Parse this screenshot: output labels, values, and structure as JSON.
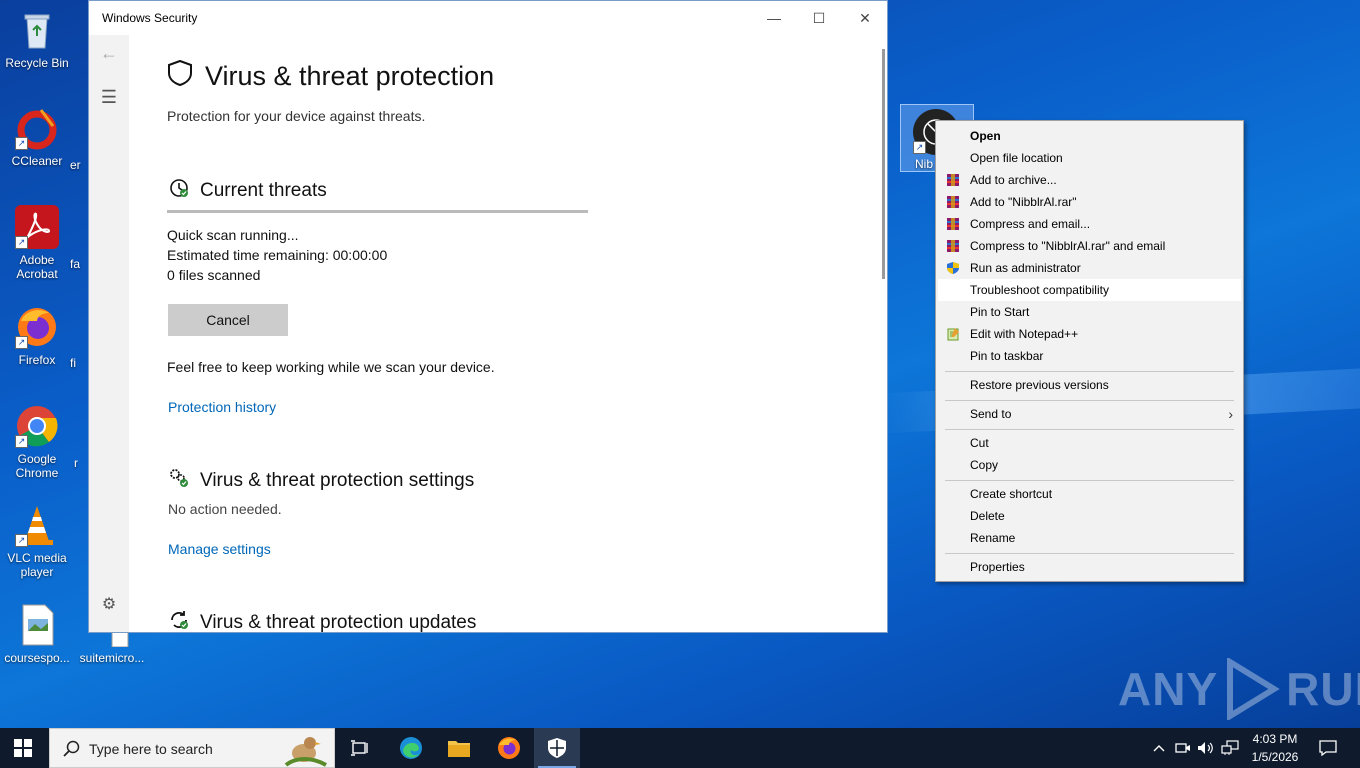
{
  "desktop": {
    "icons": [
      {
        "label": "Recycle Bin"
      },
      {
        "label": "CCleaner"
      },
      {
        "label": "Adobe Acrobat"
      },
      {
        "label": "Firefox"
      },
      {
        "label": "Google Chrome"
      },
      {
        "label": "VLC media player"
      },
      {
        "label": "coursespo..."
      },
      {
        "label": "suitemicro..."
      }
    ],
    "partial_labels": [
      "er",
      "fa",
      "fi",
      "r"
    ],
    "selected_icon_label": "Nib"
  },
  "window": {
    "title": "Windows Security",
    "page_title": "Virus & threat protection",
    "subtitle": "Protection for your device against threats.",
    "current_threats": {
      "heading": "Current threats",
      "progress": 1.0,
      "status": "Quick scan running...",
      "time_label": "Estimated time remaining:",
      "time_value": "00:00:00",
      "files_count": "0",
      "files_label": "files scanned",
      "cancel_label": "Cancel",
      "note": "Feel free to keep working while we scan your device.",
      "history_link": "Protection history"
    },
    "settings": {
      "heading": "Virus & threat protection settings",
      "status": "No action needed.",
      "link": "Manage settings"
    },
    "updates": {
      "heading": "Virus & threat protection updates"
    }
  },
  "context_menu": {
    "items": [
      {
        "label": "Open",
        "bold": true
      },
      {
        "label": "Open file location"
      },
      {
        "label": "Add to archive...",
        "icon": "winrar-icon"
      },
      {
        "label": "Add to \"NibblrAl.rar\"",
        "icon": "winrar-icon"
      },
      {
        "label": "Compress and email...",
        "icon": "winrar-icon"
      },
      {
        "label": "Compress to \"NibblrAl.rar\" and email",
        "icon": "winrar-icon"
      },
      {
        "label": "Run as administrator",
        "icon": "uac-shield-icon"
      },
      {
        "label": "Troubleshoot compatibility",
        "highlight": true
      },
      {
        "label": "Pin to Start"
      },
      {
        "label": "Edit with Notepad++",
        "icon": "notepadpp-icon"
      },
      {
        "label": "Pin to taskbar"
      },
      {
        "label": "Restore previous versions"
      },
      {
        "label": "Send to",
        "submenu": true
      },
      {
        "label": "Cut"
      },
      {
        "label": "Copy"
      },
      {
        "label": "Create shortcut"
      },
      {
        "label": "Delete"
      },
      {
        "label": "Rename"
      },
      {
        "label": "Properties"
      }
    ]
  },
  "watermark": {
    "left": "ANY",
    "right": "RUN"
  },
  "taskbar": {
    "search_placeholder": "Type here to search",
    "time": "4:03 PM",
    "date": "1/5/2026"
  }
}
